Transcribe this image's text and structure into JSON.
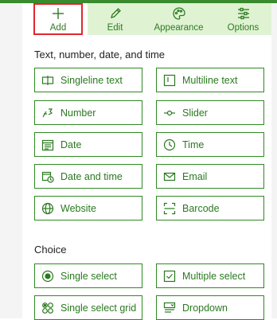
{
  "tabs": [
    {
      "label": "Add",
      "icon": "plus-icon"
    },
    {
      "label": "Edit",
      "icon": "pencil-icon"
    },
    {
      "label": "Appearance",
      "icon": "palette-icon"
    },
    {
      "label": "Options",
      "icon": "sliders-icon"
    }
  ],
  "sections": [
    {
      "title": "Text, number, date, and time",
      "items": [
        {
          "label": "Singleline text",
          "icon": "singleline-text-icon"
        },
        {
          "label": "Multiline text",
          "icon": "multiline-text-icon"
        },
        {
          "label": "Number",
          "icon": "number-icon"
        },
        {
          "label": "Slider",
          "icon": "slider-icon"
        },
        {
          "label": "Date",
          "icon": "calendar-icon"
        },
        {
          "label": "Time",
          "icon": "clock-icon"
        },
        {
          "label": "Date and time",
          "icon": "calendar-clock-icon"
        },
        {
          "label": "Email",
          "icon": "email-icon"
        },
        {
          "label": "Website",
          "icon": "globe-icon"
        },
        {
          "label": "Barcode",
          "icon": "barcode-icon"
        }
      ]
    },
    {
      "title": "Choice",
      "items": [
        {
          "label": "Single select",
          "icon": "radio-icon"
        },
        {
          "label": "Multiple select",
          "icon": "checkbox-icon"
        },
        {
          "label": "Single select grid",
          "icon": "grid-select-icon"
        },
        {
          "label": "Dropdown",
          "icon": "dropdown-icon"
        }
      ]
    }
  ],
  "colors": {
    "accent": "#2f8a23",
    "tab_bg": "#dff3d3",
    "highlight": "#e0262e"
  }
}
